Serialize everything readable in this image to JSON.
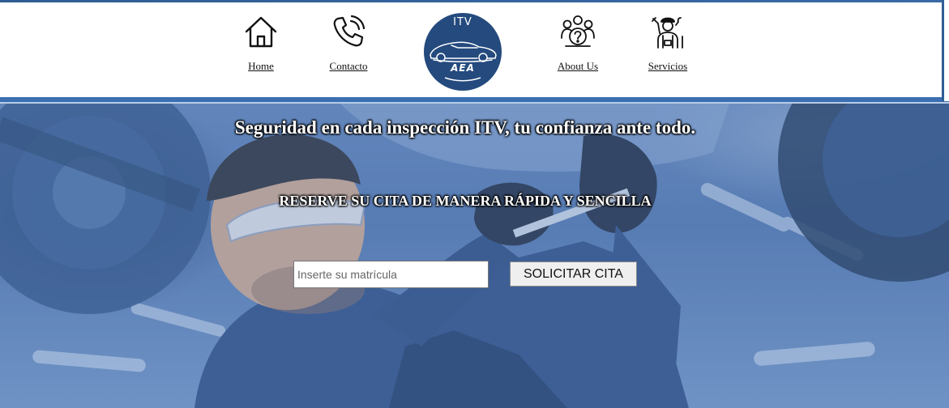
{
  "nav": {
    "home": {
      "label": "Home",
      "icon": "home-icon"
    },
    "contact": {
      "label": "Contacto",
      "icon": "phone-icon"
    },
    "about": {
      "label": "About Us",
      "icon": "team-icon"
    },
    "services": {
      "label": "Servicios",
      "icon": "mechanic-icon"
    }
  },
  "logo": {
    "top_text": "ITV",
    "bottom_text": "AEA"
  },
  "hero": {
    "title": "Seguridad en cada inspección ITV, tu confianza ante todo.",
    "subtitle": "RESERVE SU CITA DE MANERA RÁPIDA Y SENCILLA",
    "plate_placeholder": "Inserte su matrícula",
    "plate_value": "",
    "button_label": "SOLICITAR CITA"
  },
  "colors": {
    "brand": "#244a7e",
    "header_line": "#3b6fb0",
    "hero_tint": "#4f74ad"
  }
}
